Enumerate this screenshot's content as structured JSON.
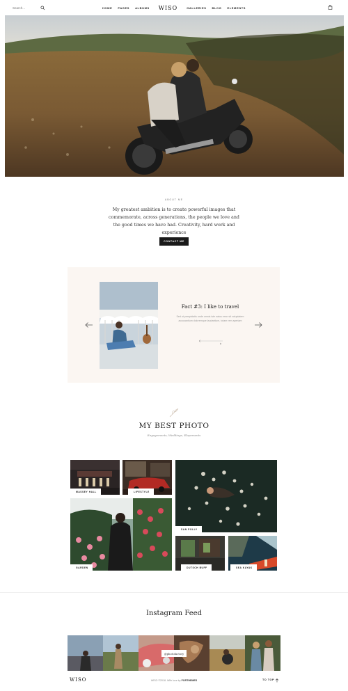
{
  "header": {
    "search_placeholder": "Search...",
    "nav_left": [
      "HOME",
      "PAGES",
      "ALBUMS"
    ],
    "logo": "WISO",
    "nav_right": [
      "GALLERIES",
      "BLOG",
      "ELEMENTS"
    ],
    "icons": {
      "search": "search-icon",
      "cart": "bag-icon"
    }
  },
  "about": {
    "eyebrow": "ABOUT ME",
    "text": "My greatest ambition is to create powerful images that commemorate, across generations, the people we love and the good times we have had. Creativity, hard work and experience",
    "button": "CONTACT ME"
  },
  "fact": {
    "title": "Fact #3: I like to travel",
    "description": "Sed ut perspiciatis unde omnis iste natus error sit voluptatem accusantium doloremque laudantium, totam rem aperiam",
    "bg_color": "#fbf6f2"
  },
  "best": {
    "title": "MY BEST PHOTO",
    "subtitle": "Engagements, Weddings, Elopements",
    "tiles": [
      "MASSEY HALL",
      "LIFESTYLE",
      "SAN POLLY",
      "GARDEN",
      "DUTSCH BUFF",
      "SEA KAYAK"
    ]
  },
  "instagram": {
    "title": "Instagram Feed",
    "handle": "@photofactory"
  },
  "footer": {
    "logo": "WISO",
    "copy_prefix": "WISO ©2018. With love by",
    "copy_brand": "FORTHEMES",
    "to_top": "TO TOP"
  },
  "colors": {
    "accent": "#1a1a1a",
    "fact_bg": "#fbf6f2"
  }
}
